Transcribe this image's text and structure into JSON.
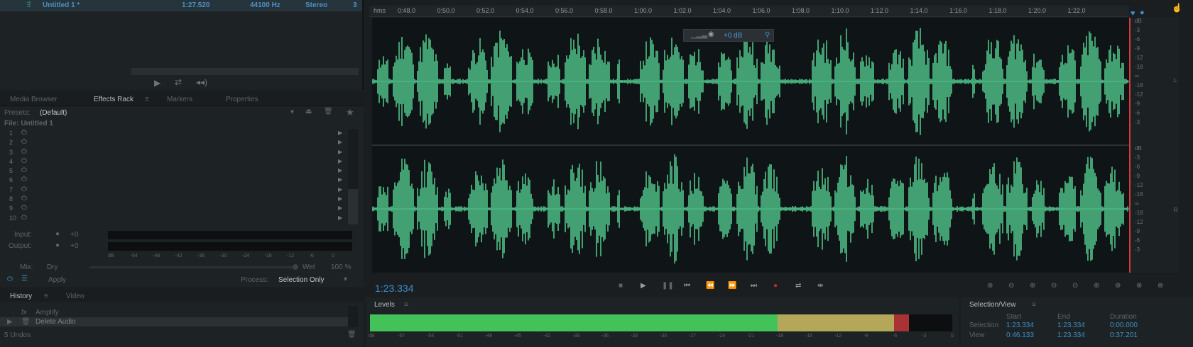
{
  "file_list": {
    "file_name": "Untitled 1 *",
    "duration": "1:27.520",
    "sample_rate": "44100 Hz",
    "channels": "Stereo",
    "bit_depth_trunc": "3"
  },
  "panel_tabs": [
    "Media Browser",
    "Effects Rack",
    "Markers",
    "Properties"
  ],
  "effects_rack": {
    "presets_label": "Presets:",
    "preset_value": "(Default)",
    "file_label": "File: Untitled 1",
    "slots": [
      "1",
      "2",
      "3",
      "4",
      "5",
      "6",
      "7",
      "8",
      "9",
      "10"
    ],
    "input_label": "Input:",
    "output_label": "Output:",
    "input_value": "+0",
    "output_value": "+0",
    "io_scale": [
      "dB",
      "-54",
      "-48",
      "-42",
      "-36",
      "-30",
      "-24",
      "-18",
      "-12",
      "-6",
      "0"
    ],
    "mix_label": "Mix:",
    "dry_label": "Dry",
    "wet_label": "Wet",
    "mix_value": "100 %",
    "apply_label": "Apply",
    "process_label": "Process:",
    "process_value": "Selection Only"
  },
  "history": {
    "tabs": [
      "History",
      "Video"
    ],
    "items": [
      "Amplify",
      "Delete Audio"
    ],
    "undos": "5 Undos"
  },
  "editor": {
    "ruler_unit": "hms",
    "ruler_ticks": [
      "0:48.0",
      "0:50.0",
      "0:52.0",
      "0:54.0",
      "0:56.0",
      "0:58.0",
      "1:00.0",
      "1:02.0",
      "1:04.0",
      "1:06.0",
      "1:08.0",
      "1:10.0",
      "1:12.0",
      "1:14.0",
      "1:16.0",
      "1:18.0",
      "1:20.0",
      "1:22.0"
    ],
    "hud_volume": "+0 dB",
    "db_scale_top": [
      "dB",
      "-3",
      "-6",
      "-9",
      "-12",
      "-18",
      "∞",
      "-18",
      "-12",
      "-9",
      "-6",
      "-3"
    ],
    "db_scale_bottom": [
      "dB",
      "-3",
      "-6",
      "-9",
      "-12",
      "-18",
      "∞",
      "-18",
      "-12",
      "-9",
      "-6",
      "-3"
    ],
    "channel_top": "L",
    "channel_bottom": "R",
    "current_time": "1:23.334",
    "wave_color": "#4fc48a"
  },
  "levels": {
    "title": "Levels",
    "scale": [
      "dB",
      "-57",
      "-54",
      "-51",
      "-48",
      "-45",
      "-42",
      "-39",
      "-36",
      "-33",
      "-30",
      "-27",
      "-24",
      "-21",
      "-18",
      "-15",
      "-12",
      "-9",
      "-6",
      "-3",
      "0"
    ],
    "green_level_db": -18,
    "yellow_level_db": -6,
    "red_level_db": -4.5
  },
  "selection_view": {
    "title": "Selection/View",
    "col_start": "Start",
    "col_end": "End",
    "col_duration": "Duration",
    "selection_label": "Selection",
    "view_label": "View",
    "selection_start": "1:23.334",
    "selection_end": "1:23.334",
    "selection_duration": "0:00.000",
    "view_start": "0:46.133",
    "view_end": "1:23.334",
    "view_duration": "0:37.201"
  }
}
